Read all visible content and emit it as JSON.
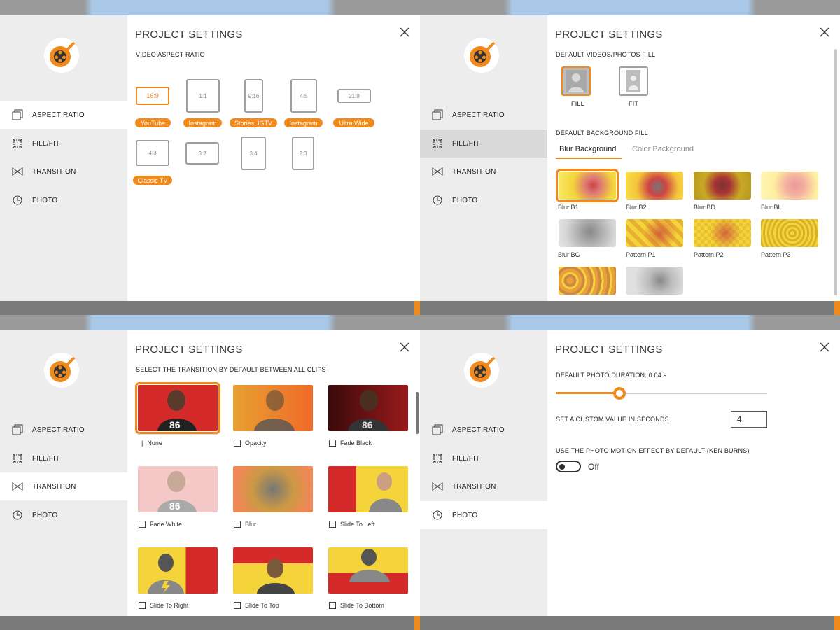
{
  "colors": {
    "accent": "#f08a1c",
    "sidebar": "#ededed",
    "active": "#ffffff"
  },
  "nav": {
    "aspect_ratio": "ASPECT RATIO",
    "fill_fit": "FILL/FIT",
    "transition": "TRANSITION",
    "photo": "PHOTO"
  },
  "dialog_title": "PROJECT SETTINGS",
  "aspect": {
    "subtitle": "VIDEO ASPECT RATIO",
    "ratios": [
      "16:9",
      "1:1",
      "9:16",
      "4:5",
      "21:9",
      "4:3",
      "3:2",
      "3:4",
      "2:3"
    ],
    "tags": [
      "YouTube",
      "Instagram",
      "Stories, IGTV",
      "Instagram",
      "Ultra Wide",
      "Classic TV"
    ],
    "selected": "16:9"
  },
  "fill": {
    "subtitle": "DEFAULT VIDEOS/PHOTOS FILL",
    "fill_label": "FILL",
    "fit_label": "FIT",
    "bg_subtitle": "DEFAULT BACKGROUND FILL",
    "tabs": [
      "Blur Background",
      "Color Background"
    ],
    "active_tab": "Blur Background",
    "backgrounds": [
      "Blur B1",
      "Blur B2",
      "Blur BD",
      "Blur BL",
      "Blur BG",
      "Pattern P1",
      "Pattern P2",
      "Pattern P3"
    ],
    "selected": "Blur B1"
  },
  "transition": {
    "subtitle": "SELECT THE TRANSITION BY DEFAULT BETWEEN ALL CLIPS",
    "items": [
      "None",
      "Opacity",
      "Fade Black",
      "Fade White",
      "Blur",
      "Slide To Left",
      "Slide To Right",
      "Slide To Top",
      "Slide To Bottom"
    ],
    "selected": "None"
  },
  "photo": {
    "duration_label": "DEFAULT PHOTO DURATION: 0:04 s",
    "duration_fraction": 0.3,
    "custom_label": "SET A CUSTOM VALUE IN SECONDS",
    "custom_value": "4",
    "motion_label": "USE THE PHOTO MOTION EFFECT BY DEFAULT (KEN BURNS)",
    "toggle_state": "Off"
  }
}
